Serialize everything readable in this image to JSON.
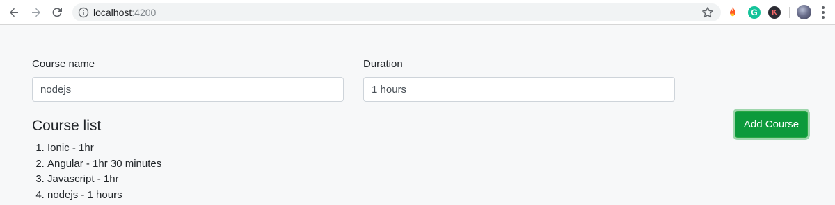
{
  "browser": {
    "url_host": "localhost",
    "url_port": ":4200",
    "extensions": {
      "grammarly_letter": "G",
      "k_letter": "K"
    }
  },
  "form": {
    "course_name_label": "Course name",
    "course_name_value": "nodejs",
    "duration_label": "Duration",
    "duration_value": "1 hours",
    "add_button_label": "Add Course"
  },
  "course_list": {
    "heading": "Course list",
    "items": [
      "Ionic - 1hr",
      "Angular - 1hr 30 minutes",
      "Javascript - 1hr",
      "nodejs - 1 hours"
    ]
  },
  "colors": {
    "button_bg": "#0d9a3c",
    "page_bg": "#f7f8f9"
  }
}
